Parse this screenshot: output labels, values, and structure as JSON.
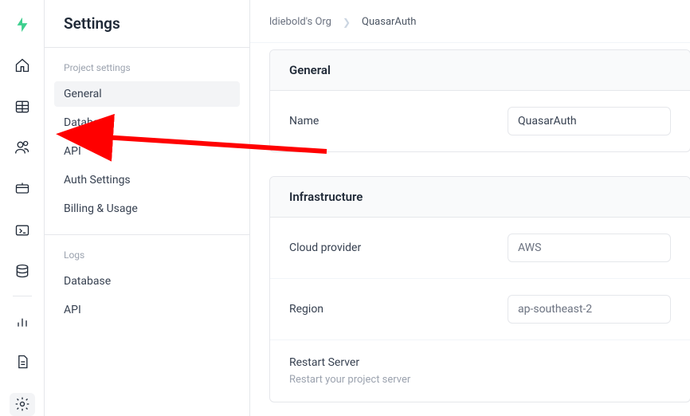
{
  "page_title": "Settings",
  "breadcrumb": {
    "org": "ldiebold's Org",
    "project": "QuasarAuth"
  },
  "sidebar": {
    "sections": [
      {
        "heading": "Project settings",
        "items": [
          {
            "label": "General",
            "active": true
          },
          {
            "label": "Database"
          },
          {
            "label": "API"
          },
          {
            "label": "Auth Settings"
          },
          {
            "label": "Billing & Usage"
          }
        ]
      },
      {
        "heading": "Logs",
        "items": [
          {
            "label": "Database"
          },
          {
            "label": "API"
          }
        ]
      }
    ]
  },
  "cards": {
    "general": {
      "title": "General",
      "name_label": "Name",
      "name_value": "QuasarAuth"
    },
    "infrastructure": {
      "title": "Infrastructure",
      "provider_label": "Cloud provider",
      "provider_value": "AWS",
      "region_label": "Region",
      "region_value": "ap-southeast-2",
      "restart_label": "Restart Server",
      "restart_sub": "Restart your project server"
    }
  },
  "colors": {
    "brand": "#3ecf8e",
    "annotation": "#ff0000"
  }
}
